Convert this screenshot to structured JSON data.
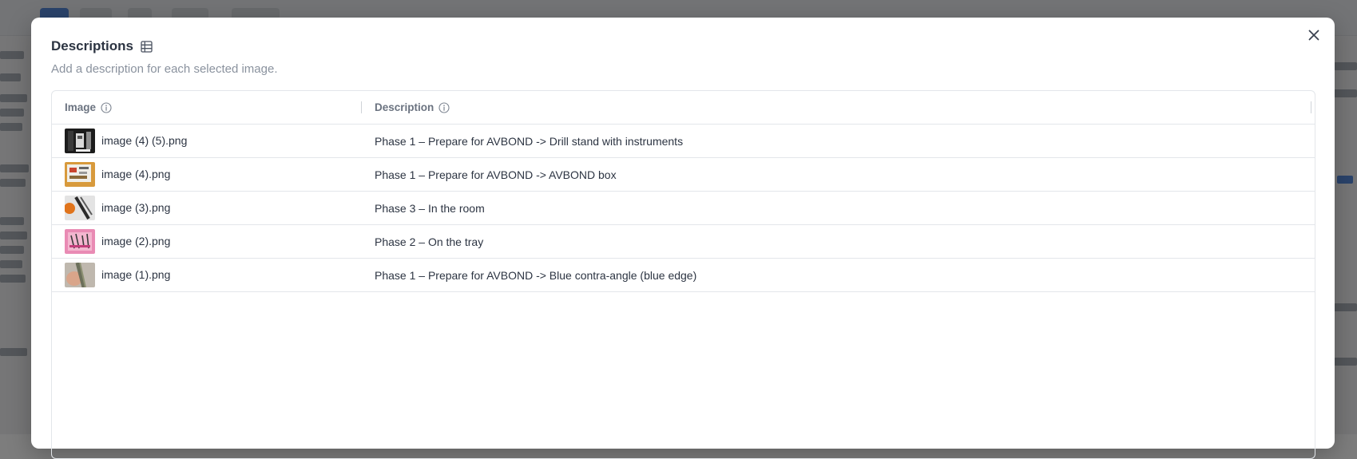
{
  "dialog": {
    "title": "Descriptions",
    "subtitle": "Add a description for each selected image."
  },
  "icons": {
    "title_icon": "table-grid-icon",
    "close_icon": "close-icon",
    "info_icon": "info-circle-icon"
  },
  "table": {
    "columns": [
      {
        "label": "Image"
      },
      {
        "label": "Description"
      }
    ],
    "rows": [
      {
        "filename": "image (4) (5).png",
        "description": "Phase 1 – Prepare for AVBOND -> Drill stand with instruments"
      },
      {
        "filename": "image (4).png",
        "description": "Phase 1 – Prepare for AVBOND -> AVBOND box"
      },
      {
        "filename": "image (3).png",
        "description": "Phase 3 – In the room"
      },
      {
        "filename": "image (2).png",
        "description": "Phase 2 – On the tray"
      },
      {
        "filename": "image (1).png",
        "description": "Phase 1 – Prepare for AVBOND -> Blue contra-angle (blue edge)"
      }
    ]
  },
  "colors": {
    "overlay": "#282828",
    "text_primary": "#2c3442",
    "text_muted": "#8a929e",
    "border": "#e3e6ea"
  }
}
